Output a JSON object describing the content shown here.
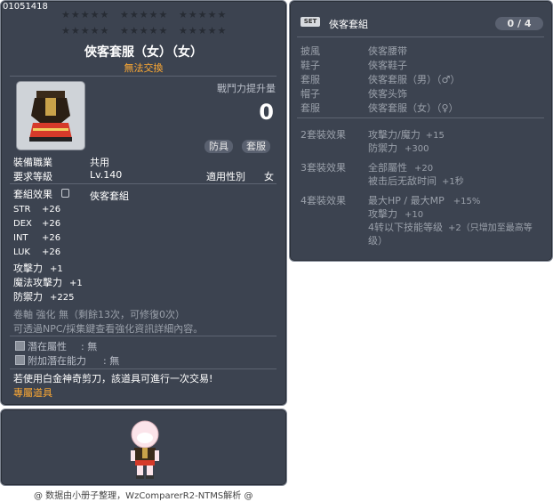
{
  "item_id": "01051418",
  "stars": [
    "★★★★★",
    "★★★★★",
    "★★★★★",
    "★★★★★",
    "★★★★★",
    "★★★★★"
  ],
  "title": "俠客套服（女）（女）",
  "trade": "無法交換",
  "power_label": "戰鬥力提升量",
  "power_value": "0",
  "tags": [
    "防具",
    "套服"
  ],
  "job": {
    "label": "裝備職業",
    "value": "共用"
  },
  "level": {
    "label": "要求等級",
    "value": "Lv.140"
  },
  "gender": {
    "label": "適用性別",
    "value": "女"
  },
  "set_effect": {
    "label": "套組效果",
    "value": "俠客套組"
  },
  "stats": [
    {
      "name": "STR",
      "value": "+26"
    },
    {
      "name": "DEX",
      "value": "+26"
    },
    {
      "name": "INT",
      "value": "+26"
    },
    {
      "name": "LUK",
      "value": "+26"
    }
  ],
  "stats_cn": [
    {
      "name": "攻擊力",
      "value": "+1"
    },
    {
      "name": "魔法攻擊力",
      "value": "+1"
    },
    {
      "name": "防禦力",
      "value": "+225"
    }
  ],
  "scroll": "卷軸 強化 無（剩餘13次，可修復0次）",
  "npc_hint": "可透過NPC/採集鍵查看強化資訊詳細內容。",
  "potential": {
    "label": "潛在屬性",
    "value": ": 無"
  },
  "add_potential": {
    "label": "附加潛在能力",
    "value": ": 無"
  },
  "platinum": "若使用白金神奇剪刀，該道具可進行一次交易!",
  "exclusive": "專屬道具",
  "set_panel": {
    "badge": "SET",
    "name": "俠客套組",
    "counter": "0 / 4",
    "pieces": [
      {
        "slot": "披風",
        "name": "俠客腰带"
      },
      {
        "slot": "鞋子",
        "name": "俠客鞋子"
      },
      {
        "slot": "套服",
        "name": "俠客套服（男）（♂）"
      },
      {
        "slot": "帽子",
        "name": "俠客头饰"
      },
      {
        "slot": "套服",
        "name": "俠客套服（女）（♀）"
      }
    ],
    "bonus2": {
      "label": "2套裝效果",
      "lines": [
        [
          "攻擊力/魔力",
          "+15"
        ],
        [
          "防禦力",
          "+300"
        ]
      ]
    },
    "bonus3": {
      "label": "3套裝效果",
      "lines": [
        [
          "全部屬性",
          "+20"
        ],
        [
          "被击后无敌时间",
          "+1秒"
        ]
      ]
    },
    "bonus4": {
      "label": "4套裝效果",
      "lines": [
        [
          "最大HP / 最大MP",
          "+15%"
        ],
        [
          "攻擊力",
          "+10"
        ],
        [
          "4转以下技能等级",
          "+2（只增加至最高等"
        ],
        [
          "级）",
          ""
        ]
      ]
    }
  },
  "footer": "@ 数据由小册子整理，WzComparerR2-NTMS解析 @"
}
